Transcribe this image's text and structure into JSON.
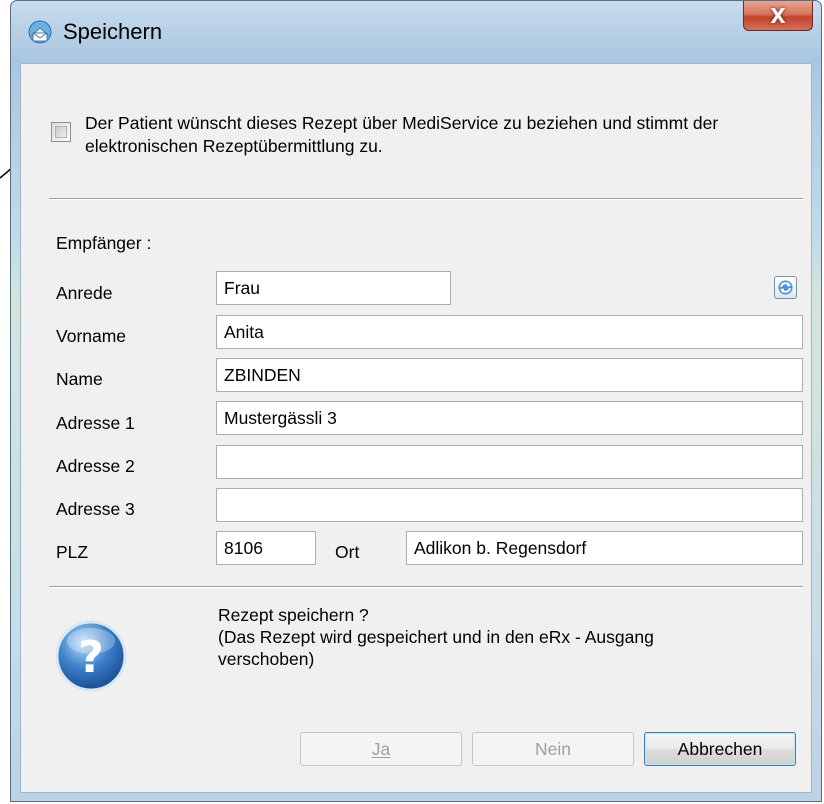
{
  "window": {
    "title": "Speichern",
    "close_label": "X"
  },
  "consent": {
    "checked": false,
    "label_line1": "Der Patient wünscht dieses Rezept über MediService zu beziehen und stimmt der",
    "label_line2": "elektronischen Rezeptübermittlung zu."
  },
  "recipient": {
    "heading": "Empfänger :",
    "fields": {
      "anrede": {
        "label": "Anrede",
        "value": "Frau"
      },
      "vorname": {
        "label": "Vorname",
        "value": "Anita"
      },
      "name": {
        "label": "Name",
        "value": "ZBINDEN"
      },
      "adresse1": {
        "label": "Adresse 1",
        "value": "Mustergässli 3"
      },
      "adresse2": {
        "label": "Adresse 2",
        "value": ""
      },
      "adresse3": {
        "label": "Adresse 3",
        "value": ""
      },
      "plz": {
        "label": "PLZ",
        "value": "8106"
      },
      "ort": {
        "label": "Ort",
        "value": "Adlikon b. Regensdorf"
      }
    }
  },
  "message": {
    "line1": "Rezept speichern ?",
    "line2": "(Das Rezept wird gespeichert und in den eRx - Ausgang",
    "line3": "verschoben)"
  },
  "buttons": {
    "ja": "Ja",
    "nein": "Nein",
    "abbrechen": "Abbrechen"
  },
  "colors": {
    "close_button": "#c4432a",
    "help_icon": "#3a7fc8",
    "default_button_border": "#3c7fb1"
  },
  "icons": {
    "title": "envelope-globe-icon",
    "refresh": "refresh-icon",
    "help": "question-icon"
  }
}
